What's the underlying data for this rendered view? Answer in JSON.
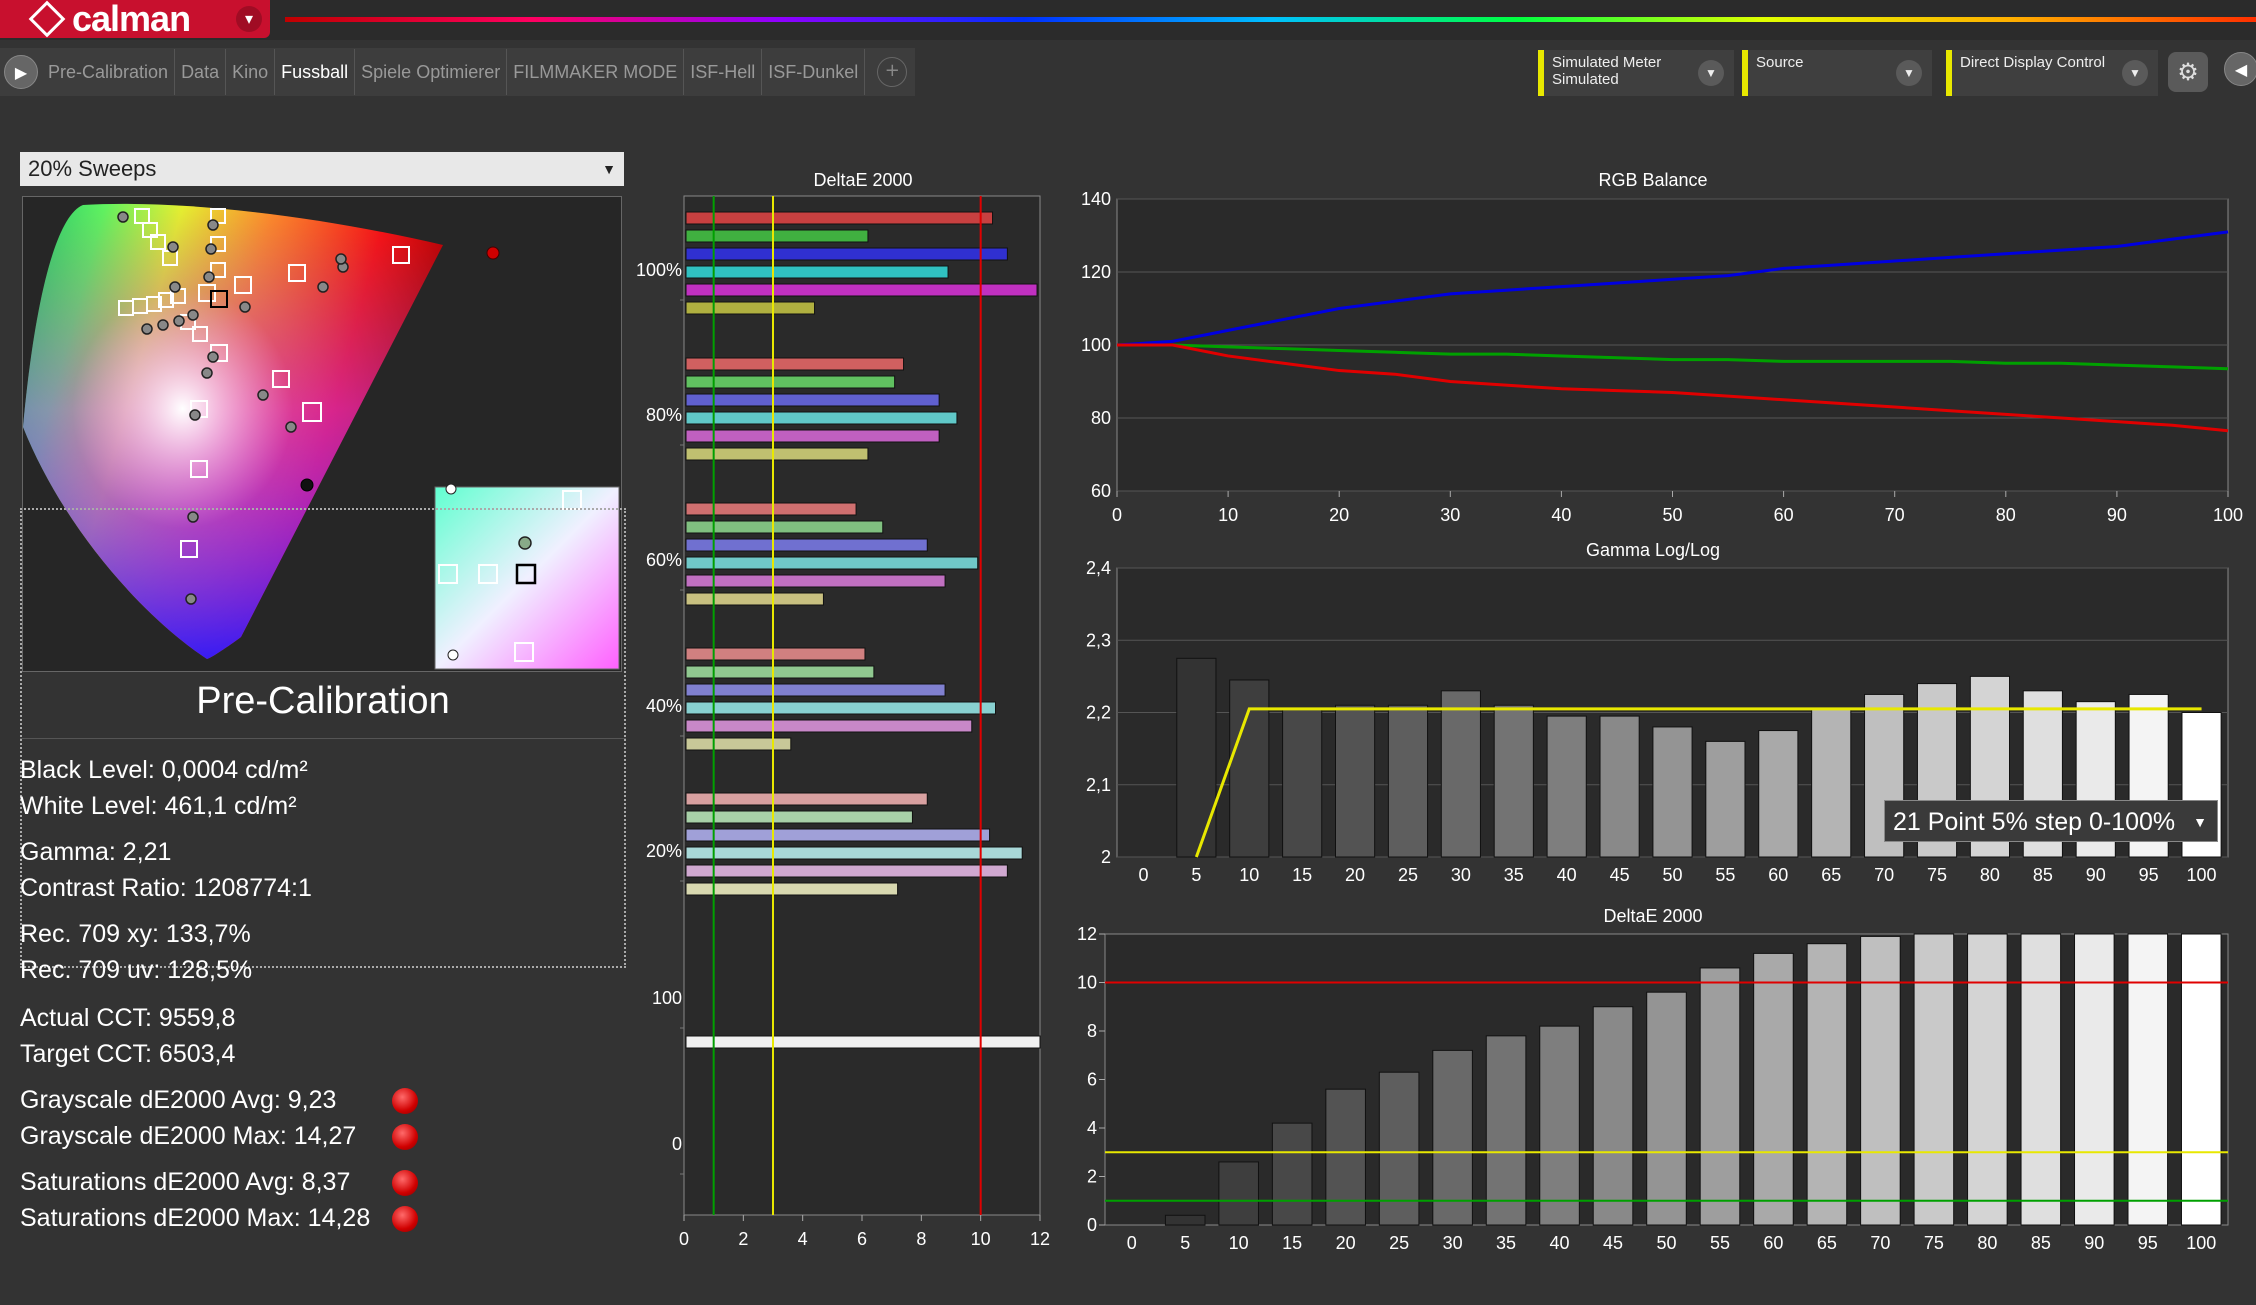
{
  "app": {
    "name": "calman"
  },
  "tabs": [
    "Pre-Calibration",
    "Data",
    "Kino",
    "Fussball",
    "Spiele Optimierer",
    "FILMMAKER MODE",
    "ISF-Hell",
    "ISF-Dunkel"
  ],
  "active_tab": "Fussball",
  "devices": {
    "meter_l1": "Simulated Meter",
    "meter_l2": "Simulated",
    "source": "Source",
    "display": "Direct Display Control"
  },
  "left": {
    "sweep_select": "20% Sweeps",
    "title": "Pre-Calibration",
    "stats": [
      "Black Level: 0,0004 cd/m²",
      "White Level: 461,1 cd/m²",
      "Gamma: 2,21",
      "Contrast Ratio: 1208774:1",
      "Rec. 709 xy: 133,7%",
      "Rec. 709 uv: 128,5%",
      "Actual CCT: 9559,8",
      "Target CCT: 6503,4",
      "Grayscale dE2000 Avg: 9,23",
      "Grayscale dE2000 Max: 14,27",
      "Saturations dE2000 Avg: 8,37",
      "Saturations dE2000 Max: 14,28"
    ]
  },
  "gamma_combo": "21 Point 5% step 0-100%",
  "colors": {
    "red": "#e00000",
    "green": "#00a000",
    "blue": "#0000e0",
    "yellow": "#e8e800",
    "accent": "#c8102e"
  },
  "chart_data": [
    {
      "type": "bar",
      "title": "DeltaE 2000",
      "orientation": "horizontal",
      "xlim": [
        0,
        12
      ],
      "x_ticks": [
        "0",
        "2",
        "4",
        "6",
        "8",
        "10",
        "12"
      ],
      "y_labels": [
        "100%",
        "80%",
        "60%",
        "40%",
        "20%",
        "100",
        "0"
      ],
      "reference_lines": [
        {
          "x": 1,
          "color": "green"
        },
        {
          "x": 3,
          "color": "yellow"
        },
        {
          "x": 10,
          "color": "red"
        }
      ],
      "groups": [
        {
          "label": "100%",
          "values": [
            10.4,
            6.2,
            10.9,
            8.9,
            11.9,
            4.4
          ]
        },
        {
          "label": "80%",
          "values": [
            7.4,
            7.1,
            8.6,
            9.2,
            8.6,
            6.2
          ]
        },
        {
          "label": "60%",
          "values": [
            5.8,
            6.7,
            8.2,
            9.9,
            8.8,
            4.7
          ]
        },
        {
          "label": "40%",
          "values": [
            6.1,
            6.4,
            8.8,
            10.5,
            9.7,
            3.6
          ]
        },
        {
          "label": "20%",
          "values": [
            8.2,
            7.7,
            10.3,
            11.4,
            10.9,
            7.2
          ]
        },
        {
          "label": "white",
          "values": [
            12.0
          ]
        }
      ]
    },
    {
      "type": "line",
      "title": "RGB Balance",
      "xlim": [
        0,
        100
      ],
      "ylim": [
        60,
        140
      ],
      "x_ticks": [
        "0",
        "10",
        "20",
        "30",
        "40",
        "50",
        "60",
        "70",
        "80",
        "90",
        "100"
      ],
      "y_ticks": [
        "140",
        "120",
        "100",
        "80",
        "60"
      ],
      "x": [
        0,
        5,
        10,
        15,
        20,
        25,
        30,
        35,
        40,
        45,
        50,
        55,
        60,
        65,
        70,
        75,
        80,
        85,
        90,
        95,
        100
      ],
      "series": [
        {
          "color": "blue",
          "values": [
            100,
            101,
            104,
            107,
            110,
            112,
            114,
            115,
            116,
            117,
            118,
            119,
            121,
            122,
            123,
            124,
            125,
            126,
            127,
            129,
            131
          ]
        },
        {
          "color": "green",
          "values": [
            100,
            100,
            99.5,
            99,
            98.5,
            98,
            97.5,
            97.5,
            97,
            96.5,
            96,
            96,
            95.5,
            95.5,
            95.5,
            95.5,
            95,
            95,
            94.5,
            94,
            93.5
          ]
        },
        {
          "color": "red",
          "values": [
            100,
            100,
            97,
            95,
            93,
            92,
            90,
            89,
            88,
            87.5,
            87,
            86,
            85,
            84,
            83,
            82,
            81,
            80,
            79,
            78,
            76.5
          ]
        }
      ]
    },
    {
      "type": "bar",
      "title": "Gamma Log/Log",
      "ylim": [
        2.0,
        2.4
      ],
      "y_ticks": [
        "2,4",
        "2,3",
        "2,2",
        "2,1",
        "2"
      ],
      "categories": [
        "0",
        "5",
        "10",
        "15",
        "20",
        "25",
        "30",
        "35",
        "40",
        "45",
        "50",
        "55",
        "60",
        "65",
        "70",
        "75",
        "80",
        "85",
        "90",
        "95",
        "100"
      ],
      "values": [
        null,
        2.275,
        2.245,
        2.205,
        2.21,
        2.21,
        2.23,
        2.21,
        2.195,
        2.195,
        2.18,
        2.16,
        2.175,
        2.205,
        2.225,
        2.24,
        2.25,
        2.23,
        2.215,
        2.225,
        2.2
      ],
      "target": {
        "color": "yellow",
        "values": [
          null,
          2.0,
          2.205,
          2.205,
          2.205,
          2.205,
          2.205,
          2.205,
          2.205,
          2.205,
          2.205,
          2.205,
          2.205,
          2.205,
          2.205,
          2.205,
          2.205,
          2.205,
          2.205,
          2.205,
          2.205
        ]
      }
    },
    {
      "type": "bar",
      "title": "DeltaE 2000",
      "ylim": [
        0,
        12
      ],
      "y_ticks": [
        "12",
        "10",
        "8",
        "6",
        "4",
        "2",
        "0"
      ],
      "categories": [
        "0",
        "5",
        "10",
        "15",
        "20",
        "25",
        "30",
        "35",
        "40",
        "45",
        "50",
        "55",
        "60",
        "65",
        "70",
        "75",
        "80",
        "85",
        "90",
        "95",
        "100"
      ],
      "values": [
        0,
        0.4,
        2.6,
        4.2,
        5.6,
        6.3,
        7.2,
        7.8,
        8.2,
        9.0,
        9.6,
        10.6,
        11.2,
        11.6,
        11.9,
        12,
        12,
        12,
        12,
        12,
        12
      ],
      "reference_lines": [
        {
          "y": 10,
          "color": "red"
        },
        {
          "y": 3,
          "color": "yellow"
        },
        {
          "y": 1,
          "color": "green"
        }
      ]
    }
  ]
}
